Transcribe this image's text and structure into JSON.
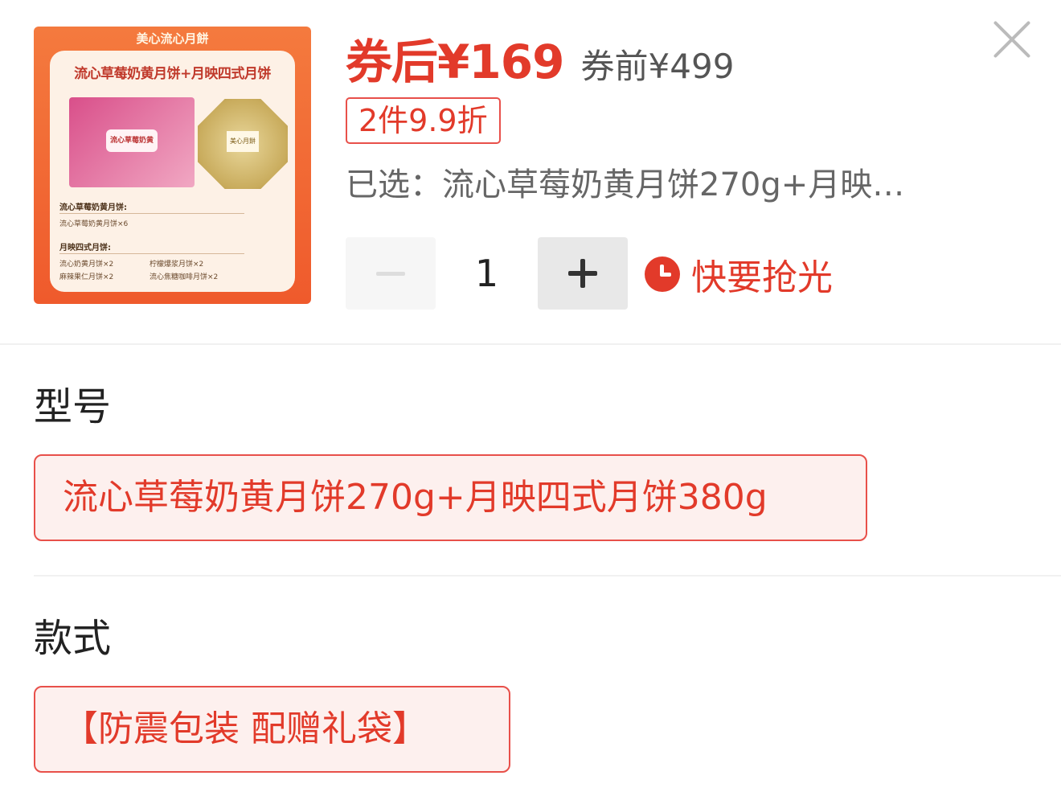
{
  "product": {
    "image": {
      "brand": "美心流心月餅",
      "title": "流心草莓奶黄月饼+月映四式月饼",
      "box_label": "流心草莓奶黄",
      "tin_label": "美心月餅",
      "section1_heading": "流心草莓奶黄月饼:",
      "section1_item": "流心草莓奶黄月饼×6",
      "section2_heading": "月映四式月饼:",
      "section2_items": [
        "流心奶黄月饼×2",
        "柠檬爆浆月饼×2",
        "麻辣果仁月饼×2",
        "流心焦糖咖啡月饼×2"
      ]
    }
  },
  "price": {
    "after_coupon": "券后¥169",
    "before_coupon": "券前¥499"
  },
  "discount_badge": "2件9.9折",
  "selected": "已选：流心草莓奶黄月饼270g+月映…",
  "quantity": {
    "value": "1",
    "minus_icon": "minus-icon",
    "plus_icon": "plus-icon"
  },
  "stock_status": {
    "icon": "clock-icon",
    "text": "快要抢光"
  },
  "close_icon": "close-icon",
  "sections": [
    {
      "title": "型号",
      "options": [
        "流心草莓奶黄月饼270g+月映四式月饼380g"
      ]
    },
    {
      "title": "款式",
      "options": [
        "【防震包装 配赠礼袋】"
      ]
    }
  ],
  "colors": {
    "accent": "#e23a2a",
    "chip_border": "#e8504a",
    "chip_bg": "#fdf0ee",
    "muted_text": "#666666"
  }
}
